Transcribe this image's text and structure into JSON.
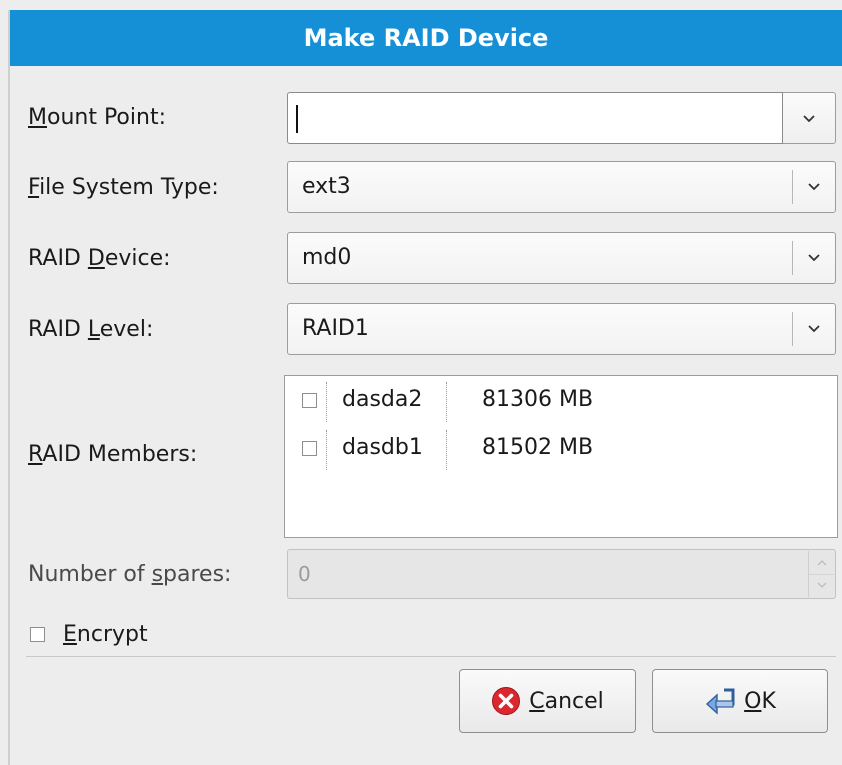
{
  "dialog": {
    "title": "Make RAID Device"
  },
  "fields": {
    "mount_point": {
      "label_mnemonic": "M",
      "label_rest": "ount Point:",
      "value": ""
    },
    "fs_type": {
      "label_mnemonic": "F",
      "label_rest": "ile System Type:",
      "value": "ext3"
    },
    "raid_device": {
      "label_pre": "RAID ",
      "label_mnemonic": "D",
      "label_rest": "evice:",
      "value": "md0"
    },
    "raid_level": {
      "label_pre": "RAID ",
      "label_mnemonic": "L",
      "label_rest": "evel:",
      "value": "RAID1"
    },
    "raid_members": {
      "label_mnemonic": "R",
      "label_rest": "AID Members:",
      "items": [
        {
          "name": "dasda2",
          "size": "81306 MB",
          "checked": false
        },
        {
          "name": "dasdb1",
          "size": "81502 MB",
          "checked": false
        }
      ]
    },
    "spares": {
      "label_pre": "Number of ",
      "label_mnemonic": "s",
      "label_rest": "pares:",
      "value": "0"
    },
    "encrypt": {
      "label_mnemonic": "E",
      "label_rest": "ncrypt",
      "checked": false
    }
  },
  "buttons": {
    "cancel": {
      "mnemonic": "C",
      "rest": "ancel",
      "icon": "cancel-icon"
    },
    "ok": {
      "mnemonic": "O",
      "rest": "K",
      "icon": "ok-icon"
    }
  },
  "colors": {
    "titlebar": "#1590d7",
    "cancel_icon": "#d9282f"
  }
}
